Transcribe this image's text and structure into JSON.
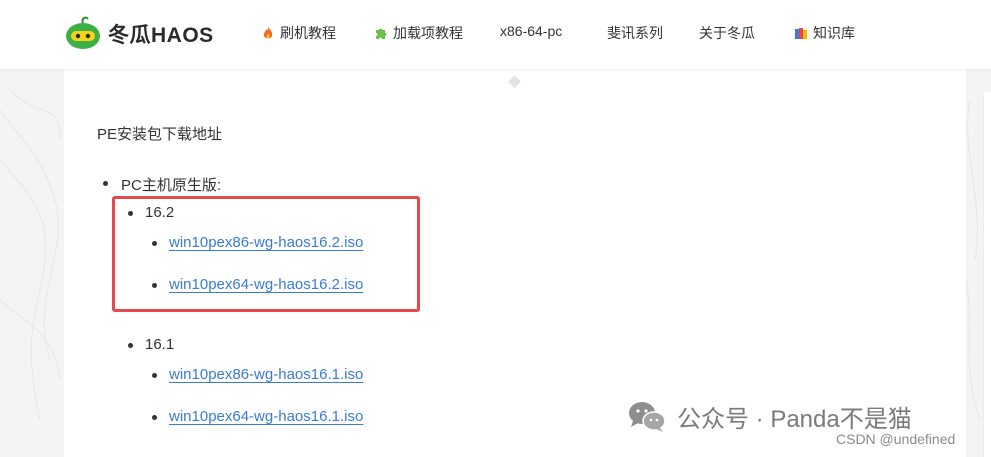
{
  "header": {
    "brand": "冬瓜HAOS",
    "nav": [
      {
        "label": "刷机教程",
        "icon": "fire-icon"
      },
      {
        "label": "加载项教程",
        "icon": "puzzle-icon"
      },
      {
        "label": "x86-64-pc",
        "icon": ""
      },
      {
        "label": "斐讯系列",
        "icon": ""
      },
      {
        "label": "关于冬瓜",
        "icon": ""
      },
      {
        "label": "知识库",
        "icon": "books-icon"
      }
    ]
  },
  "content": {
    "title": "PE安装包下载地址",
    "section_label": "PC主机原生版:",
    "versions": [
      {
        "label": "16.2",
        "links": [
          "win10pex86-wg-haos16.2.iso",
          "win10pex64-wg-haos16.2.iso"
        ]
      },
      {
        "label": "16.1",
        "links": [
          "win10pex86-wg-haos16.1.iso",
          "win10pex64-wg-haos16.1.iso"
        ]
      }
    ]
  },
  "watermark": {
    "text": "公众号 · Panda不是猫",
    "csdn": "CSDN @undefined"
  },
  "colors": {
    "link": "#3a7bd5",
    "highlight": "#e5484d",
    "logo_green": "#3cb043",
    "logo_yellow": "#f5d31b"
  }
}
